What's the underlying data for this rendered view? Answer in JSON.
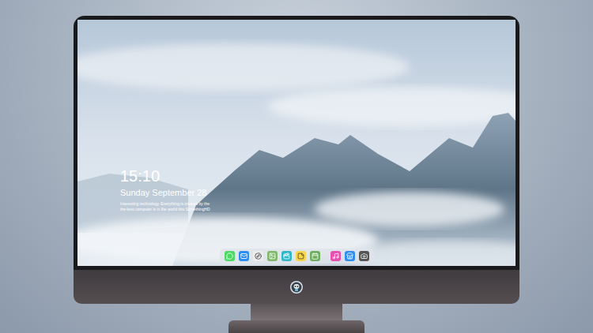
{
  "screen": {
    "time": "15:10",
    "date": "Sunday September 28",
    "caption": [
      "Interesting technology. Everything is created by the",
      "the best computer is in the world  this SomethingHD"
    ]
  },
  "dock": {
    "apps": [
      {
        "color": "#4cd964"
      },
      {
        "color": "#2b8ef0"
      },
      {
        "color": "#ececec"
      },
      {
        "color": "#7fb86a"
      },
      {
        "color": "#2fb6c9"
      },
      {
        "color": "#f7d64a"
      },
      {
        "color": "#6fae5f"
      },
      {
        "color": "#e84fb0"
      },
      {
        "color": "#2f8cf0"
      },
      {
        "color": "#555555"
      }
    ]
  }
}
